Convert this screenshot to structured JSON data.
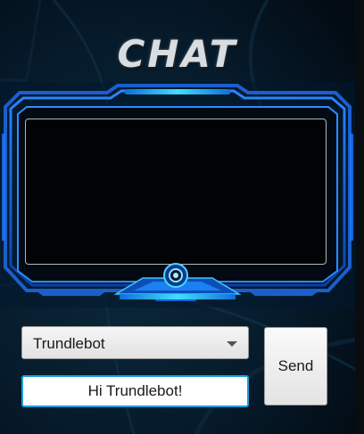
{
  "app": {
    "title": "CHAT"
  },
  "chat": {
    "messages": []
  },
  "controls": {
    "bot_select": {
      "value": "Trundlebot"
    },
    "message_input": {
      "value": "Hi Trundlebot!"
    },
    "send_label": "Send"
  },
  "theme": {
    "background": "#03111e",
    "frame_blue": "#1d6fe0",
    "frame_cyan": "#23c8ff",
    "display_bg": "#020304",
    "input_focus_border": "#1a9fe0"
  },
  "icons": {
    "frame_emblem": "circle-emblem-icon",
    "dropdown": "chevron-down-icon"
  }
}
